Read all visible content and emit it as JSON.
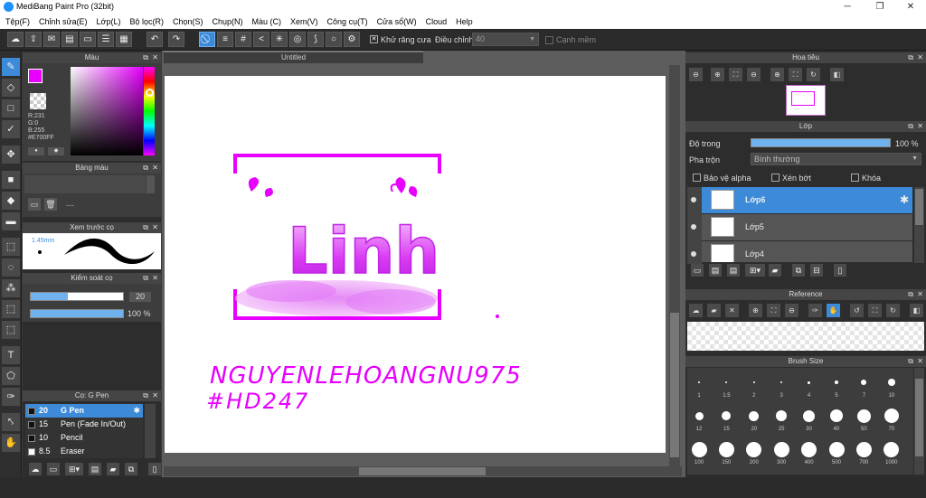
{
  "window": {
    "title": "MediBang Paint Pro (32bit)",
    "minimize": "─",
    "maximize": "❐",
    "close": "✕"
  },
  "menu": [
    "Tệp(F)",
    "Chỉnh sửa(E)",
    "Lớp(L)",
    "Bộ lọc(R)",
    "Chọn(S)",
    "Chụp(N)",
    "Màu (C)",
    "Xem(V)",
    "Công cụ(T)",
    "Cửa sổ(W)",
    "Cloud",
    "Help"
  ],
  "toolbar": {
    "antialias_label": "Khử răng cưa",
    "correction_label": "Điều chỉnh",
    "correction_value": "40",
    "snap_label": "Cạnh mềm"
  },
  "color_panel": {
    "title": "Màu",
    "r": "R:231",
    "g": "G:0",
    "b": "B:255",
    "hex": "#E700FF",
    "current_color": "#E700FF"
  },
  "palette_panel": {
    "title": "Bảng màu",
    "empty": "---"
  },
  "preview_panel": {
    "title": "Xem trước cọ",
    "size": "1.45mm"
  },
  "control_panel": {
    "title": "Kiểm soát cọ",
    "size": "20",
    "opacity": "100 %",
    "size_fill": 0.4,
    "opacity_fill": 1.0
  },
  "brush_panel": {
    "title": "Cọ: G Pen",
    "brushes": [
      {
        "size": "20",
        "name": "G Pen"
      },
      {
        "size": "15",
        "name": "Pen (Fade In/Out)"
      },
      {
        "size": "10",
        "name": "Pencil"
      },
      {
        "size": "8.5",
        "name": "Eraser"
      }
    ]
  },
  "canvas": {
    "tab": "Untitled",
    "text_line1": "NGUYENLEHOANGNU975",
    "text_line2": "#HD247",
    "logo_word": "Linh",
    "ink_color": "#E700FF"
  },
  "navigator_panel": {
    "title": "Hoa tiêu"
  },
  "layer_panel": {
    "title": "Lớp",
    "opacity_label": "Độ trong",
    "opacity_value": "100 %",
    "blend_label": "Pha trộn",
    "blend_value": "Bình thường",
    "protect_alpha": "Bảo vệ alpha",
    "clipping": "Xén bớt",
    "lock": "Khóa",
    "layers": [
      "Lớp6",
      "Lớp5",
      "Lớp4"
    ]
  },
  "reference_panel": {
    "title": "Reference"
  },
  "brush_size_panel": {
    "title": "Brush Size",
    "sizes": [
      "1",
      "1.5",
      "2",
      "3",
      "4",
      "5",
      "7",
      "10",
      "12",
      "15",
      "20",
      "25",
      "30",
      "40",
      "50",
      "70",
      "100",
      "150",
      "200",
      "300",
      "400",
      "500",
      "700",
      "1000"
    ]
  },
  "accent_color": "#3C8AD8"
}
